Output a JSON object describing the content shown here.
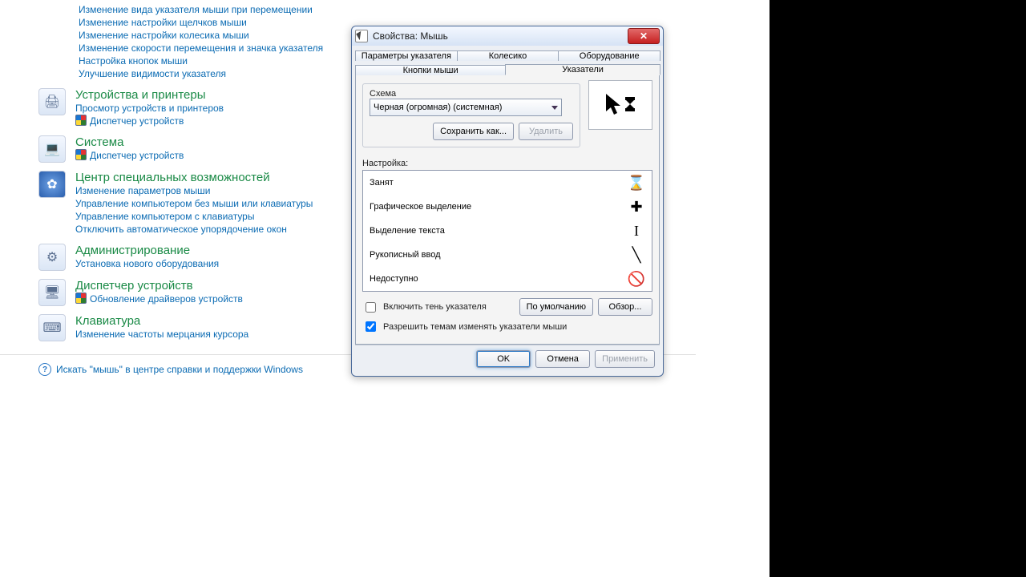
{
  "cp": {
    "toplinks": [
      "Изменение вида указателя мыши при перемещении",
      "Изменение настройки щелчков мыши",
      "Изменение настройки колесика мыши",
      "Изменение скорости перемещения и значка указателя",
      "Настройка кнопок мыши",
      "Улучшение видимости указателя"
    ],
    "sec1": {
      "title": "Устройства и принтеры",
      "l1": "Просмотр устройств и принтеров",
      "l2": "Диспетчер устройств"
    },
    "sec2": {
      "title": "Система",
      "l1": "Диспетчер устройств"
    },
    "sec3": {
      "title": "Центр специальных возможностей",
      "l1": "Изменение параметров мыши",
      "l2": "Управление компьютером без мыши или клавиатуры",
      "l3": "Управление компьютером с клавиатуры",
      "l4": "Отключить автоматическое упорядочение окон"
    },
    "sec4": {
      "title": "Администрирование",
      "l1": "Установка нового оборудования"
    },
    "sec5": {
      "title": "Диспетчер устройств",
      "l1": "Обновление драйверов устройств"
    },
    "sec6": {
      "title": "Клавиатура",
      "l1": "Изменение частоты мерцания курсора"
    },
    "help": "Искать \"мышь\" в центре справки и поддержки Windows"
  },
  "dlg": {
    "title": "Свойства: Мышь",
    "tabs": {
      "t1": "Параметры указателя",
      "t2": "Колесико",
      "t3": "Оборудование",
      "t4": "Кнопки мыши",
      "t5": "Указатели"
    },
    "scheme_label": "Схема",
    "scheme_value": "Черная (огромная) (системная)",
    "save_as": "Сохранить как...",
    "delete": "Удалить",
    "customize_label": "Настройка:",
    "rows": {
      "r1": "Занят",
      "r2": "Графическое выделение",
      "r3": "Выделение текста",
      "r4": "Рукописный ввод",
      "r5": "Недоступно"
    },
    "chk_shadow": "Включить тень указателя",
    "chk_theme": "Разрешить темам изменять указатели мыши",
    "btn_default": "По умолчанию",
    "btn_browse": "Обзор...",
    "btn_ok": "OK",
    "btn_cancel": "Отмена",
    "btn_apply": "Применить"
  }
}
